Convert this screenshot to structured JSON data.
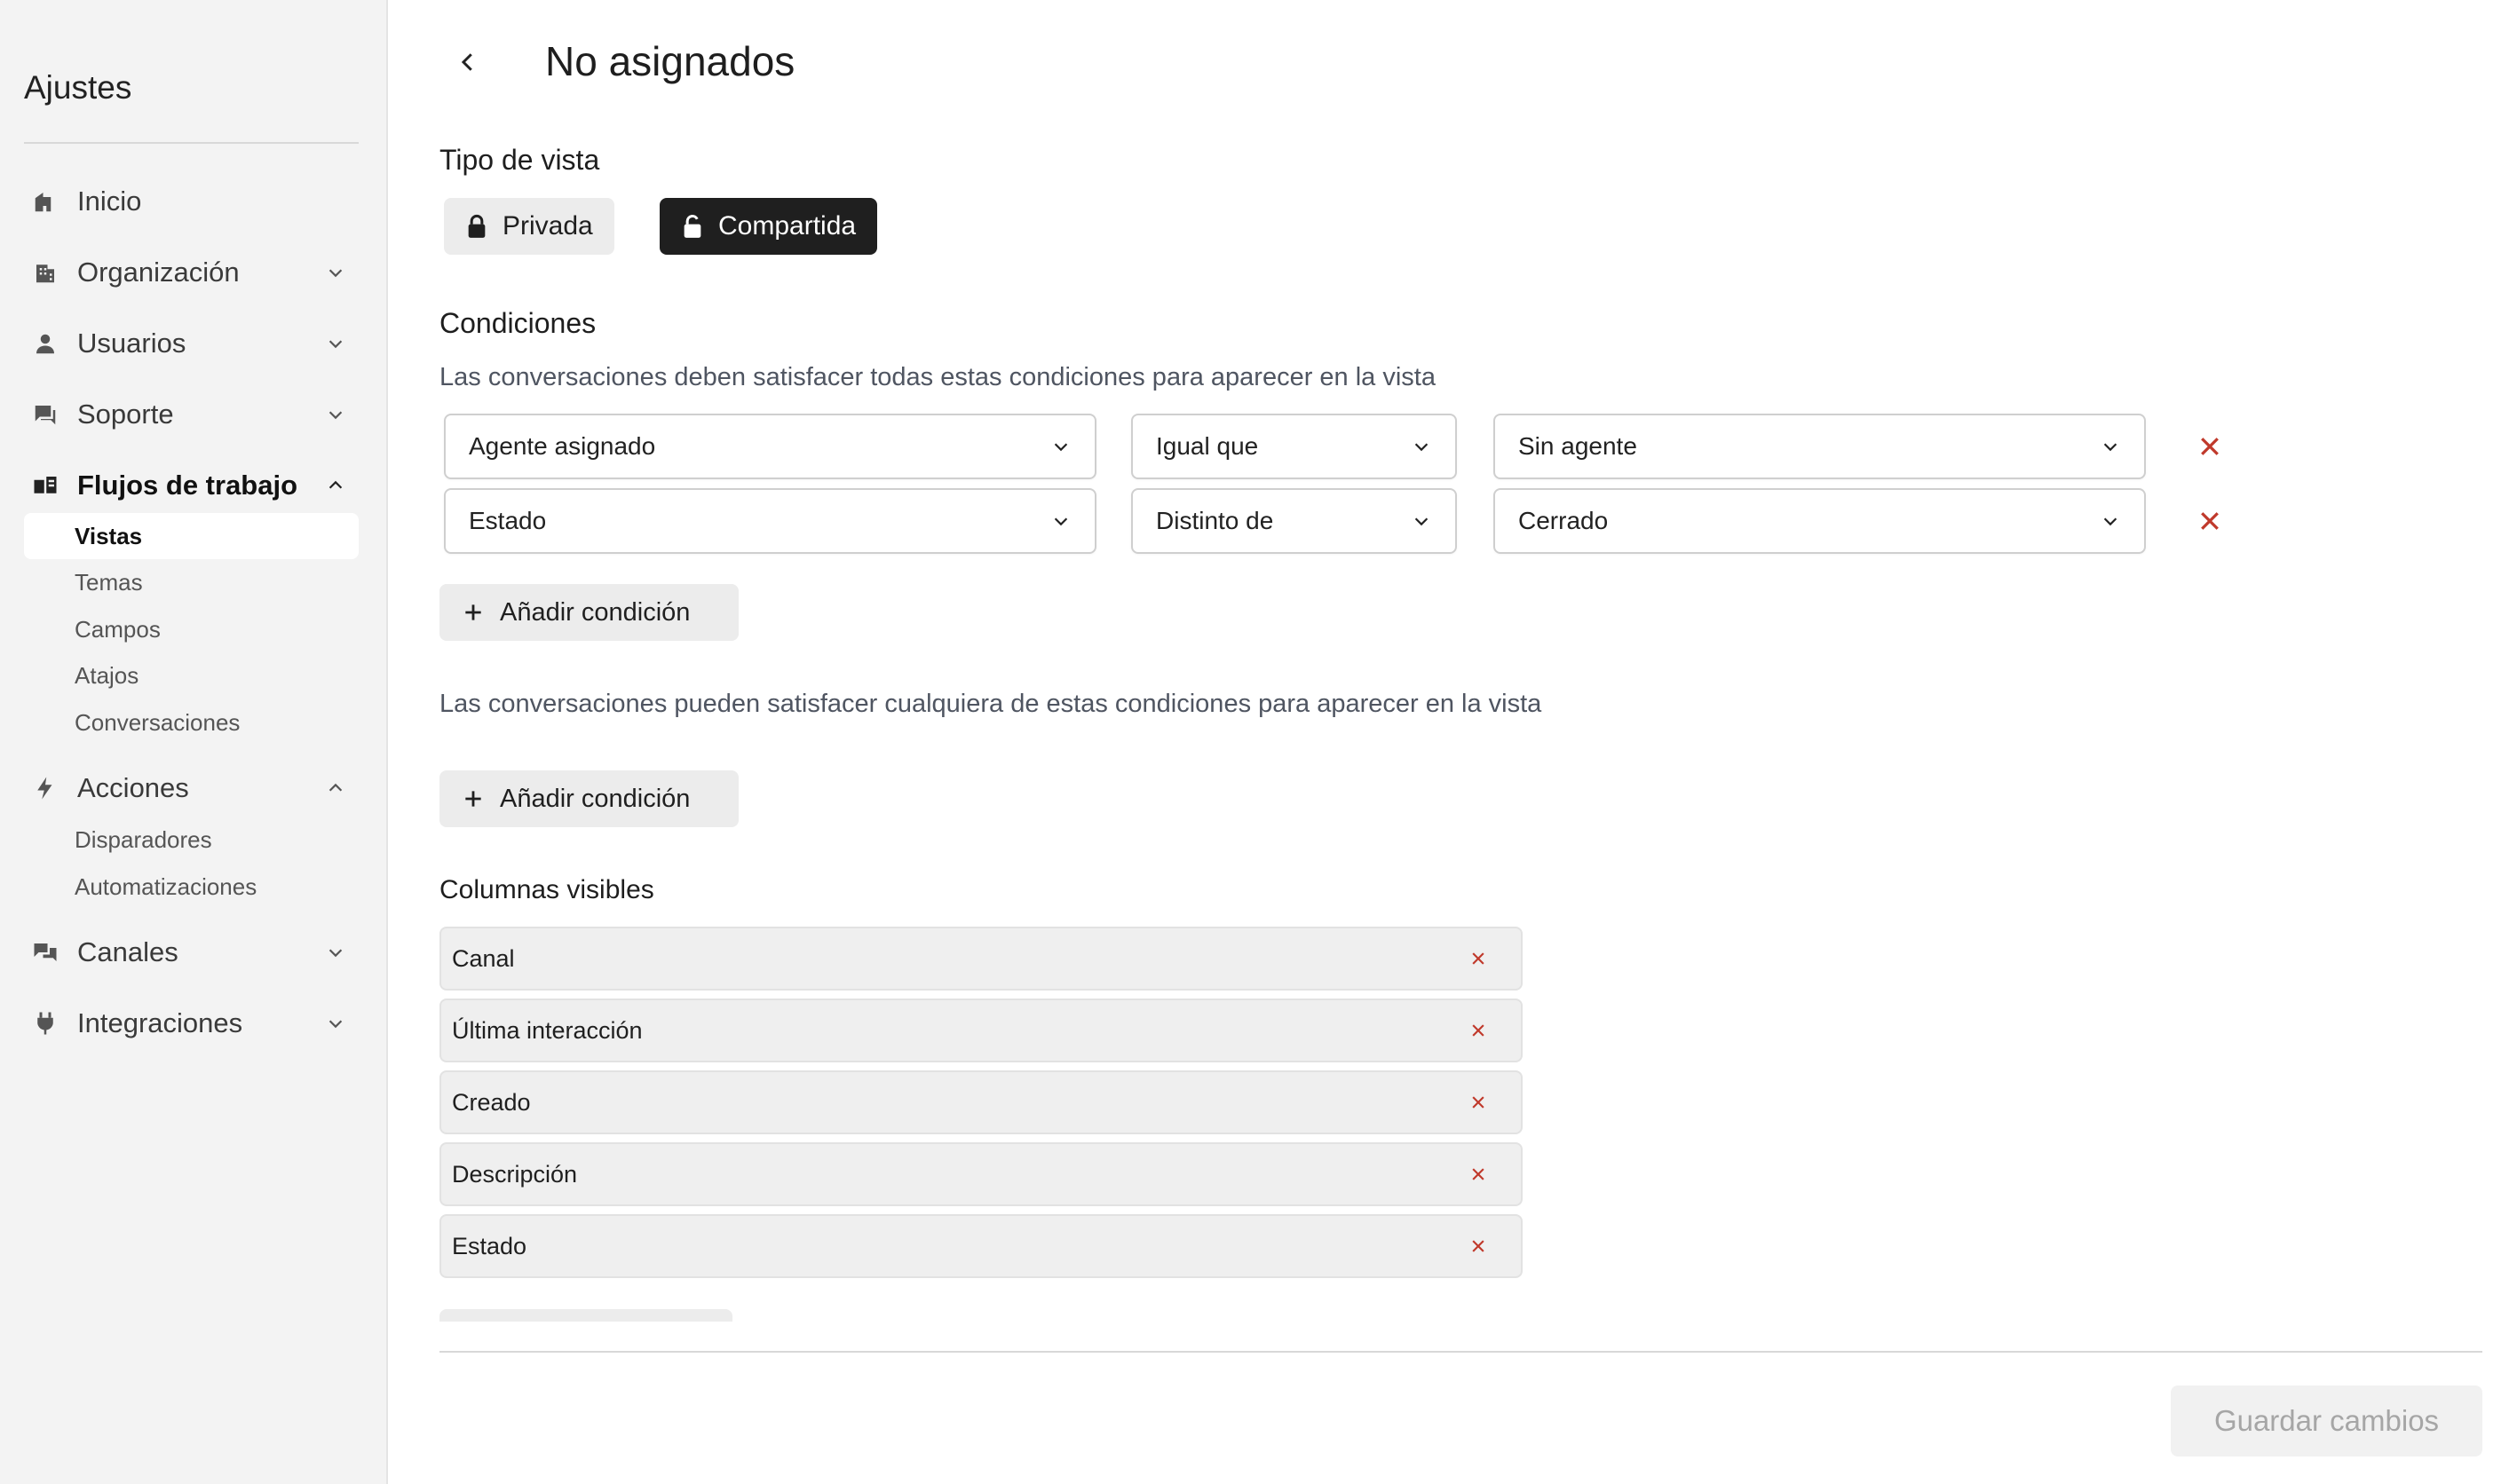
{
  "sidebar": {
    "title": "Ajustes",
    "items": [
      {
        "label": "Inicio",
        "icon": "home-icon"
      },
      {
        "label": "Organización",
        "icon": "building-icon"
      },
      {
        "label": "Usuarios",
        "icon": "user-icon"
      },
      {
        "label": "Soporte",
        "icon": "chat-icon"
      },
      {
        "label": "Flujos de trabajo",
        "icon": "workflow-icon"
      },
      {
        "label": "Acciones",
        "icon": "lightning-icon"
      },
      {
        "label": "Canales",
        "icon": "channels-icon"
      },
      {
        "label": "Integraciones",
        "icon": "plug-icon"
      }
    ],
    "workflow_subitems": [
      "Vistas",
      "Temas",
      "Campos",
      "Atajos",
      "Conversaciones"
    ],
    "action_subitems": [
      "Disparadores",
      "Automatizaciones"
    ]
  },
  "header": {
    "title": "No asignados"
  },
  "view_type": {
    "title": "Tipo de vista",
    "private_label": "Privada",
    "shared_label": "Compartida",
    "selected": "Compartida"
  },
  "conditions": {
    "title": "Condiciones",
    "all_description": "Las conversaciones deben satisfacer todas estas condiciones para aparecer en la vista",
    "all_rows": [
      {
        "field": "Agente asignado",
        "operator": "Igual que",
        "value": "Sin agente"
      },
      {
        "field": "Estado",
        "operator": "Distinto de",
        "value": "Cerrado"
      }
    ],
    "add_label": "Añadir condición",
    "any_description": "Las conversaciones pueden satisfacer cualquiera de estas condiciones para aparecer en la vista"
  },
  "columns": {
    "title": "Columnas visibles",
    "items": [
      "Canal",
      "Última interacción",
      "Creado",
      "Descripción",
      "Estado"
    ]
  },
  "footer": {
    "save_label": "Guardar cambios"
  },
  "colors": {
    "remove": "#c0392b",
    "dark_pill": "#1f1f1f"
  }
}
